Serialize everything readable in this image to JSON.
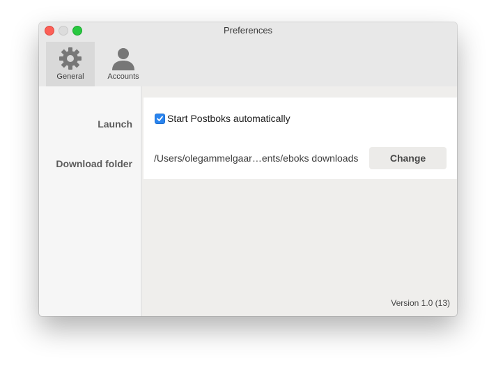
{
  "window": {
    "title": "Preferences"
  },
  "toolbar": {
    "items": [
      {
        "label": "General",
        "icon": "gear-icon",
        "selected": true
      },
      {
        "label": "Accounts",
        "icon": "person-icon",
        "selected": false
      }
    ]
  },
  "settings": {
    "launch": {
      "label": "Launch",
      "checkbox_label": "Start Postboks automatically",
      "checked": true
    },
    "download_folder": {
      "label": "Download folder",
      "path": "/Users/olegammelgaar…ents/eboks downloads",
      "button_label": "Change"
    }
  },
  "footer": {
    "version": "Version 1.0 (13)"
  },
  "colors": {
    "close": "#fc5f57",
    "zoom": "#28c840",
    "checkbox_accent": "#2a84ee"
  }
}
